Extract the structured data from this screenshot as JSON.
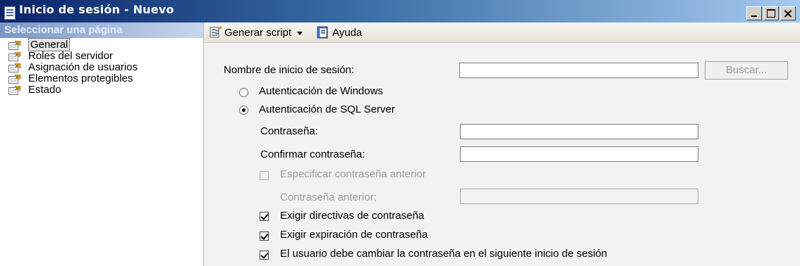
{
  "window": {
    "title": "Inicio de sesión - Nuevo",
    "controls": [
      "minimize",
      "maximize",
      "close"
    ]
  },
  "sidebar": {
    "header": "Seleccionar una página",
    "items": [
      {
        "label": "General",
        "selected": true,
        "icon": "page-icon"
      },
      {
        "label": "Roles del servidor",
        "selected": false,
        "icon": "page-icon"
      },
      {
        "label": "Asignación de usuarios",
        "selected": false,
        "icon": "page-icon"
      },
      {
        "label": "Elementos protegibles",
        "selected": false,
        "icon": "page-icon"
      },
      {
        "label": "Estado",
        "selected": false,
        "icon": "page-icon"
      }
    ]
  },
  "toolbar": {
    "script_label": "Generar script",
    "help_label": "Ayuda",
    "script_icon": "script-icon",
    "help_icon": "help-icon"
  },
  "form": {
    "login_name_label": "Nombre de inicio de sesión:",
    "login_name_value": "",
    "search_button": "Buscar...",
    "auth_windows_label": "Autenticación de Windows",
    "auth_windows_selected": false,
    "auth_sql_label": "Autenticación de SQL Server",
    "auth_sql_selected": true,
    "password_label": "Contraseña:",
    "password_value": "",
    "confirm_password_label": "Confirmar contraseña:",
    "confirm_password_value": "",
    "specify_old_password_label": "Especificar contraseña anterior",
    "specify_old_password_checked": false,
    "old_password_label": "Contraseña anterior:",
    "old_password_value": "",
    "enforce_policy_label": "Exigir directivas de contraseña",
    "enforce_policy_checked": true,
    "enforce_expiration_label": "Exigir expiración de contraseña",
    "enforce_expiration_checked": true,
    "must_change_label": "El usuario debe cambiar la contraseña en el siguiente inicio de sesión",
    "must_change_checked": true
  },
  "colors": {
    "titlebar_start": "#0a246a",
    "titlebar_end": "#a6caf0",
    "panel_header": "#7a96c4",
    "form_background": "#f2f2f2",
    "disabled_text": "#9a9a9a"
  }
}
